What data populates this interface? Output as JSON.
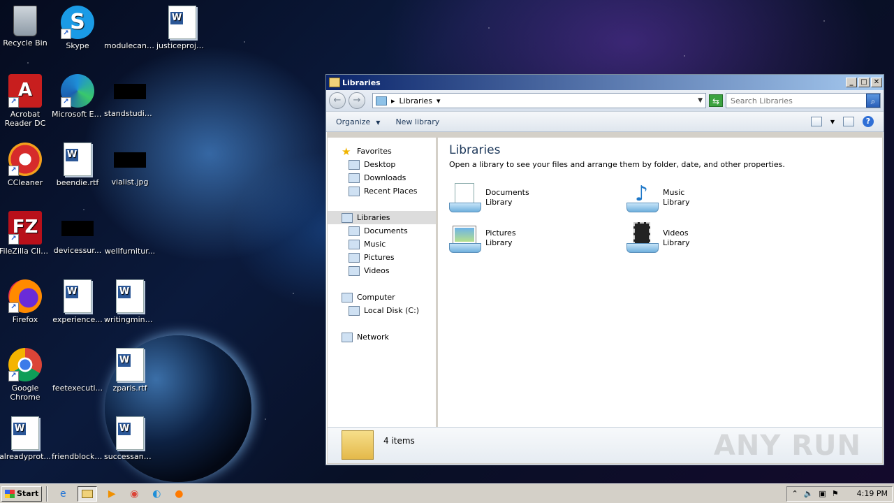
{
  "desktop": {
    "icons": [
      {
        "label": "Recycle Bin"
      },
      {
        "label": "Skype"
      },
      {
        "label": "modulecanc..."
      },
      {
        "label": "justiceproje..."
      },
      {
        "label": "Acrobat Reader DC"
      },
      {
        "label": "Microsoft Edge"
      },
      {
        "label": "standstudie..."
      },
      {
        "label": "CCleaner"
      },
      {
        "label": "beendie.rtf"
      },
      {
        "label": "vialist.jpg"
      },
      {
        "label": "FileZilla Client"
      },
      {
        "label": "devicessur..."
      },
      {
        "label": "wellfurnitur..."
      },
      {
        "label": "Firefox"
      },
      {
        "label": "experience..."
      },
      {
        "label": "writingminu..."
      },
      {
        "label": "Google Chrome"
      },
      {
        "label": "feetexecuti..."
      },
      {
        "label": "zparis.rtf"
      },
      {
        "label": "alreadyprot..."
      },
      {
        "label": "friendblock...."
      },
      {
        "label": "successanal..."
      }
    ]
  },
  "window": {
    "title": "Libraries",
    "address": {
      "crumb": "Libraries",
      "sep": "▸"
    },
    "search_placeholder": "Search Libraries",
    "toolbar": {
      "organize": "Organize",
      "new_library": "New library"
    },
    "nav": {
      "favorites": "Favorites",
      "desktop": "Desktop",
      "downloads": "Downloads",
      "recent": "Recent Places",
      "libraries": "Libraries",
      "documents": "Documents",
      "music": "Music",
      "pictures": "Pictures",
      "videos": "Videos",
      "computer": "Computer",
      "local_disk": "Local Disk (C:)",
      "network": "Network"
    },
    "content": {
      "heading": "Libraries",
      "description": "Open a library to see your files and arrange them by folder, date, and other properties.",
      "libraries": [
        {
          "name": "Documents",
          "type": "Library"
        },
        {
          "name": "Music",
          "type": "Library"
        },
        {
          "name": "Pictures",
          "type": "Library"
        },
        {
          "name": "Videos",
          "type": "Library"
        }
      ]
    },
    "status": {
      "count": "4 items"
    },
    "watermark": "ANY RUN"
  },
  "taskbar": {
    "start_label": "Start",
    "clock": "4:19 PM"
  }
}
